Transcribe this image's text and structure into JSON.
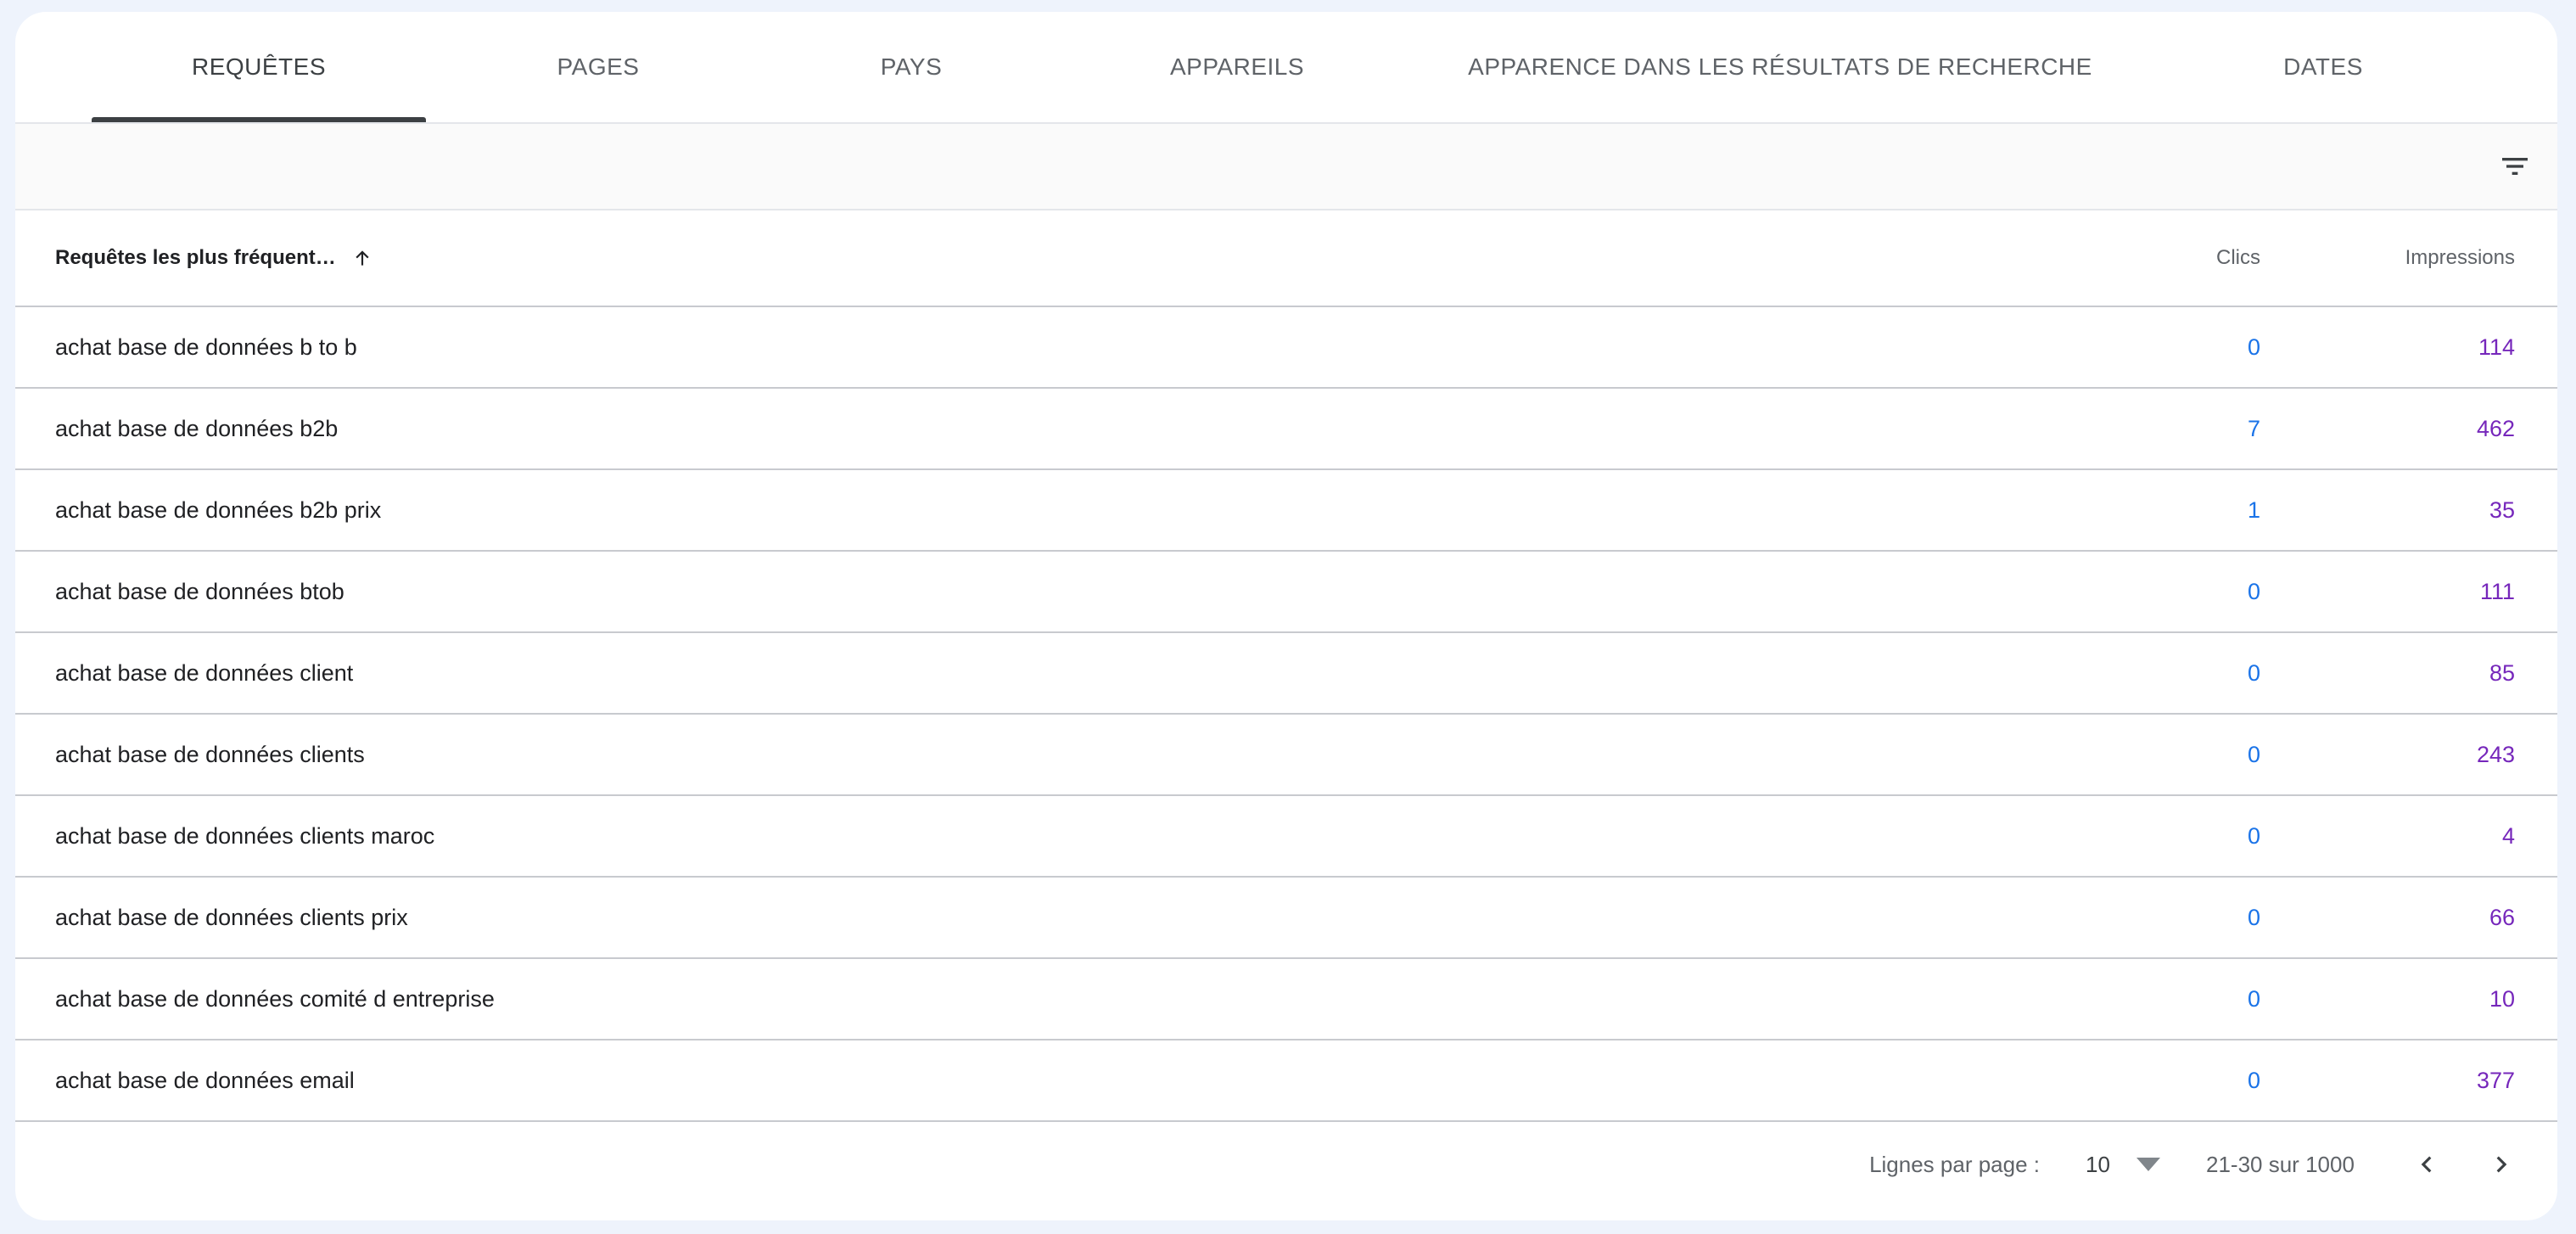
{
  "tabs": [
    {
      "label": "REQUÊTES",
      "active": true
    },
    {
      "label": "PAGES",
      "active": false
    },
    {
      "label": "PAYS",
      "active": false
    },
    {
      "label": "APPAREILS",
      "active": false
    },
    {
      "label": "APPARENCE DANS LES RÉSULTATS DE RECHERCHE",
      "active": false
    },
    {
      "label": "DATES",
      "active": false
    }
  ],
  "filter": {
    "icon": "filter-icon"
  },
  "table": {
    "headers": {
      "query": "Requêtes les plus fréquent…",
      "query_sort_icon": "arrow-up-icon",
      "clics": "Clics",
      "impressions": "Impressions"
    },
    "rows": [
      {
        "query": "achat base de données b to b",
        "clics": "0",
        "impressions": "114"
      },
      {
        "query": "achat base de données b2b",
        "clics": "7",
        "impressions": "462"
      },
      {
        "query": "achat base de données b2b prix",
        "clics": "1",
        "impressions": "35"
      },
      {
        "query": "achat base de données btob",
        "clics": "0",
        "impressions": "111"
      },
      {
        "query": "achat base de données client",
        "clics": "0",
        "impressions": "85"
      },
      {
        "query": "achat base de données clients",
        "clics": "0",
        "impressions": "243"
      },
      {
        "query": "achat base de données clients maroc",
        "clics": "0",
        "impressions": "4"
      },
      {
        "query": "achat base de données clients prix",
        "clics": "0",
        "impressions": "66"
      },
      {
        "query": "achat base de données comité d entreprise",
        "clics": "0",
        "impressions": "10"
      },
      {
        "query": "achat base de données email",
        "clics": "0",
        "impressions": "377"
      }
    ]
  },
  "pagination": {
    "rows_per_page_label": "Lignes par page :",
    "rows_per_page_value": "10",
    "range": "21-30 sur 1000",
    "prev_icon": "chevron-left-icon",
    "next_icon": "chevron-right-icon"
  },
  "colors": {
    "clics": "#1a73e8",
    "impressions": "#7627bb",
    "background": "#eef3fc"
  }
}
